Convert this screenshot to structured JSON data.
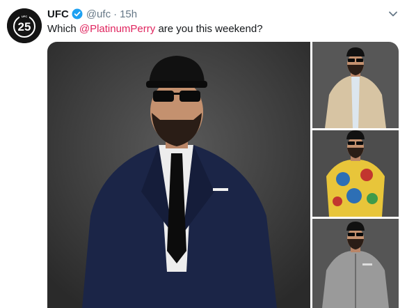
{
  "tweet": {
    "author_name": "UFC",
    "handle": "@ufc",
    "separator": "·",
    "time": "15h",
    "text_prefix": "Which ",
    "mention": "@PlatinumPerry",
    "text_suffix": " are you this weekend?",
    "avatar_label": "25"
  },
  "icons": {
    "verified": "verified-badge-icon",
    "caret": "chevron-down-icon"
  },
  "media": [
    {
      "alt": "Perry in navy suit, black tie, cap and sunglasses"
    },
    {
      "alt": "Perry in beige blazer"
    },
    {
      "alt": "Perry in colorful patterned t-shirt"
    },
    {
      "alt": "Perry in gray zip hoodie"
    }
  ],
  "colors": {
    "link": "#e0245e",
    "verified": "#1da1f2",
    "secondary_text": "#657786",
    "primary_text": "#14171a"
  }
}
